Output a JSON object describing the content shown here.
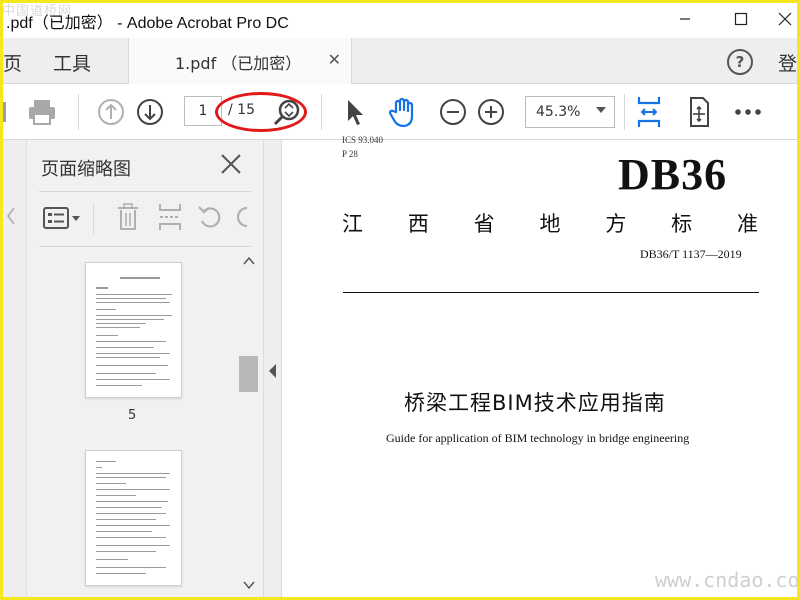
{
  "window": {
    "title": ".pdf（已加密） - Adobe Acrobat Pro DC",
    "watermark": "中国道桥网"
  },
  "menubar": {
    "items": [
      "页",
      "工具"
    ],
    "doc_tab_label": "1.pdf （已加密）",
    "help": "?",
    "login": "登"
  },
  "toolbar": {
    "current_page": "1",
    "total_pages": "/ 15",
    "zoom": "45.3%"
  },
  "panel": {
    "title": "页面缩略图",
    "thumbnails": [
      {
        "label": "5"
      },
      {
        "label": ""
      }
    ]
  },
  "document": {
    "header_line1": "ICS 93.040",
    "header_line2": "P 28",
    "code": "DB36",
    "standard_type": [
      "江",
      "西",
      "省",
      "地",
      "方",
      "标",
      "准"
    ],
    "standard_number": "DB36/T 1137—2019",
    "title_cn": "桥梁工程BIM技术应用指南",
    "title_en": "Guide for application of BIM technology in bridge engineering"
  },
  "watermark_site": "www.cndao.com"
}
